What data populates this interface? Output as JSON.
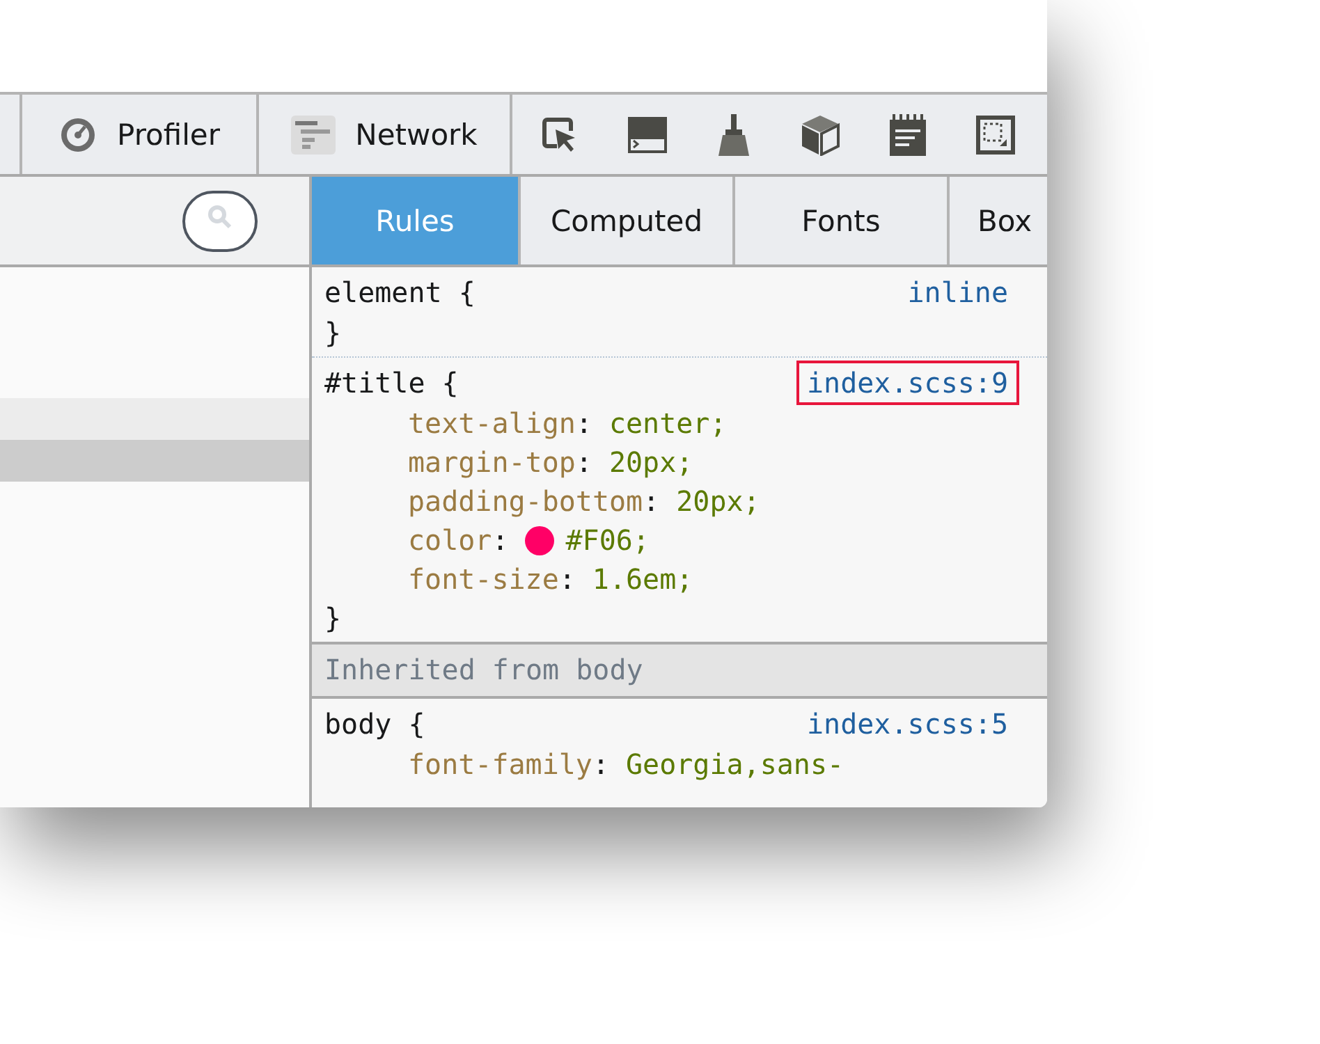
{
  "toolbar": {
    "tabs": [
      {
        "label": "Profiler"
      },
      {
        "label": "Network"
      }
    ]
  },
  "markup_panel": {
    "rows": [
      {
        "selected": false,
        "hovered": true
      },
      {
        "selected": true
      }
    ]
  },
  "sidebar_tabs": [
    {
      "label": "Rules",
      "selected": true
    },
    {
      "label": "Computed",
      "selected": false
    },
    {
      "label": "Fonts",
      "selected": false
    },
    {
      "label": "Box",
      "selected": false
    }
  ],
  "rules": [
    {
      "kind": "rule",
      "selector": "element {",
      "source": "inline",
      "highlighted": false,
      "closing": "}"
    },
    {
      "kind": "rule",
      "selector": "#title {",
      "source": "index.scss:9",
      "highlighted": true,
      "declarations": [
        {
          "property": "text-align",
          "colon": ":",
          "value": "center;"
        },
        {
          "property": "margin-top",
          "colon": ":",
          "value": "20px;"
        },
        {
          "property": "padding-bottom",
          "colon": ":",
          "value": "20px;"
        },
        {
          "property": "color",
          "colon": ":",
          "value": "#F06;",
          "color": "#ff0066"
        },
        {
          "property": "font-size",
          "colon": ":",
          "value": "1.6em;"
        }
      ],
      "closing": "}"
    },
    {
      "kind": "header",
      "text": "Inherited from body"
    },
    {
      "kind": "rule",
      "selector": "body {",
      "source": "index.scss:5",
      "highlighted": false,
      "declarations": [
        {
          "property": "font-family",
          "colon": ":",
          "value": "Georgia,sans-"
        }
      ]
    }
  ]
}
